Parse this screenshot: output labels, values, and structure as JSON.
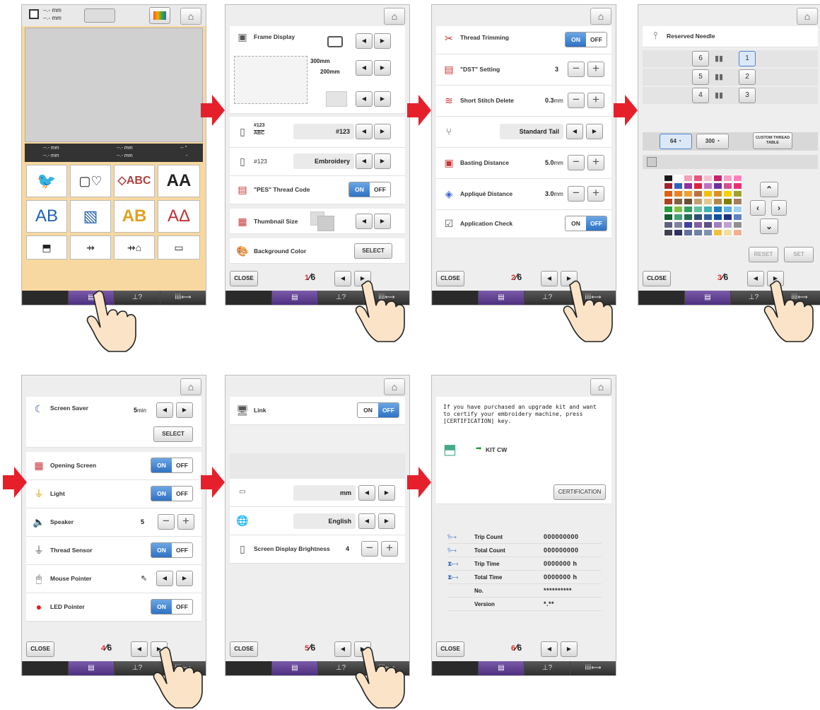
{
  "home_screen": {
    "size_top1": "--.- mm",
    "size_top2": "--.- mm",
    "info": [
      [
        "--.- mm",
        "--.- mm",
        "-- °"
      ],
      [
        "--.- mm",
        "--.- mm",
        "-"
      ]
    ],
    "tiles": [
      [
        "bird",
        "frame-heart",
        "monogram",
        "AA"
      ],
      [
        "AB",
        "A-frame",
        "AB",
        "AΔ"
      ],
      [
        "machine",
        "usb",
        "usb-mouse",
        "computer"
      ]
    ]
  },
  "common": {
    "close_label": "CLOSE",
    "total_pages": "6",
    "bottom_tabs": [
      "",
      "▤",
      "⊥?",
      "iiii⟷"
    ]
  },
  "page1": {
    "page_no": "1",
    "frame_display": "Frame Display",
    "frame_w": "300mm",
    "frame_h": "200mm",
    "thread_num_top": "#123",
    "thread_num_bottom": "ABC",
    "thread_num_value": "#123",
    "thread_name_label": "#123",
    "thread_name_value": "Embroidery",
    "pes_code": "\"PES\" Thread Code",
    "thumbnail": "Thumbnail Size",
    "bg_color": "Background Color",
    "select": "SELECT",
    "on": "ON",
    "off": "OFF"
  },
  "page2": {
    "page_no": "2",
    "trimming": "Thread Trimming",
    "dst": "\"DST\" Setting",
    "dst_value": "3",
    "short_stitch": "Short Stitch Delete",
    "short_value": "0.3",
    "tail": "Standard Tail",
    "basting": "Basting Distance",
    "basting_value": "5.0",
    "applique": "Appliqué Distance",
    "applique_value": "3.0",
    "app_check": "Application Check",
    "mm": "mm",
    "on": "ON",
    "off": "OFF"
  },
  "page3": {
    "page_no": "3",
    "reserved": "Reserved Needle",
    "needles": [
      [
        "6",
        "1"
      ],
      [
        "5",
        "2"
      ],
      [
        "4",
        "3"
      ]
    ],
    "chip1": "64",
    "chip2": "300",
    "custom": "CUSTOM THREAD TABLE",
    "reset": "RESET",
    "set": "SET",
    "palette_colors": [
      "#1a1a1a",
      "#ffffff",
      "#f2a0b8",
      "#e8557a",
      "#f4c0d0",
      "#c9226f",
      "#f4a0c0",
      "#ff7fbf",
      "#a52030",
      "#3060c0",
      "#9030a0",
      "#e02040",
      "#c070c0",
      "#7030a0",
      "#d05090",
      "#e83070",
      "#e06010",
      "#f08020",
      "#f0a030",
      "#c07040",
      "#f0c000",
      "#e09020",
      "#f8d000",
      "#a0a030",
      "#b04020",
      "#806040",
      "#6a5030",
      "#c0a070",
      "#e0c890",
      "#b08850",
      "#808000",
      "#a08060",
      "#20a040",
      "#80c040",
      "#30a060",
      "#60c0a0",
      "#40b0b0",
      "#2080c0",
      "#60b0e0",
      "#a0d0f0",
      "#106030",
      "#40a070",
      "#207050",
      "#305070",
      "#3060a0",
      "#1050a0",
      "#203080",
      "#6080c0",
      "#606080",
      "#8080a0",
      "#4040a0",
      "#8060a0",
      "#605080",
      "#a080c0",
      "#c0a0d0",
      "#909090",
      "#404050",
      "#303060",
      "#6070a0",
      "#7080a0",
      "#8090b0",
      "#f0c040",
      "#f0e0a0",
      "#f0b090"
    ]
  },
  "page4": {
    "page_no": "4",
    "saver": "Screen Saver",
    "saver_value": "5",
    "min": "min",
    "select": "SELECT",
    "opening": "Opening Screen",
    "light": "Light",
    "speaker": "Speaker",
    "speaker_value": "5",
    "sensor": "Thread Sensor",
    "mouse": "Mouse Pointer",
    "led": "LED Pointer",
    "on": "ON",
    "off": "OFF"
  },
  "page5": {
    "page_no": "5",
    "link": "Link",
    "unit_value": "mm",
    "language_value": "English",
    "brightness": "Screen Display Brightness",
    "brightness_value": "4",
    "on": "ON",
    "off": "OFF"
  },
  "page6": {
    "page_no": "6",
    "message": "If you have purchased an upgrade kit and want to certify your embroidery machine, press [CERTIFICATION] key.",
    "kit": "KIT CW",
    "certification": "CERTIFICATION",
    "stats": [
      {
        "label": "Trip Count",
        "value": "000000000",
        "unit": ""
      },
      {
        "label": "Total Count",
        "value": "000000000",
        "unit": ""
      },
      {
        "label": "Trip Time",
        "value": "0000000",
        "unit": "h"
      },
      {
        "label": "Total Time",
        "value": "0000000",
        "unit": "h"
      },
      {
        "label": "No.",
        "value": "**********",
        "unit": ""
      },
      {
        "label": "Version",
        "value": "*.**",
        "unit": ""
      }
    ]
  }
}
